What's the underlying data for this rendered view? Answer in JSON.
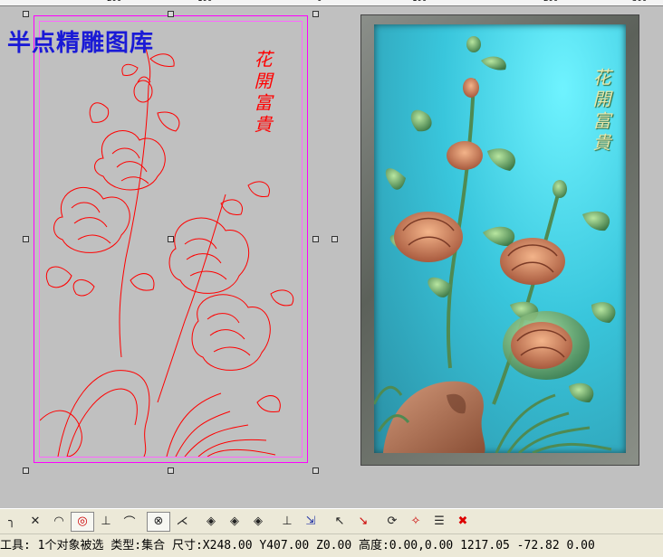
{
  "ruler": {
    "labels": [
      "200",
      "100",
      "0",
      "100",
      "200",
      "300"
    ]
  },
  "watermark": "半点精雕图库",
  "drawing": {
    "caption": "花開富貴",
    "line_color": "#ff0000"
  },
  "relief": {
    "caption": "花開富貴"
  },
  "toolbar": {
    "buttons": [
      {
        "name": "arc-tool-icon",
        "glyph": "╮"
      },
      {
        "name": "trim-tool-icon",
        "glyph": "✕"
      },
      {
        "name": "fillet-tool-icon",
        "glyph": "◠"
      },
      {
        "name": "circle-point-tool-icon",
        "glyph": "◎"
      },
      {
        "name": "perpendicular-tool-icon",
        "glyph": "⊥"
      },
      {
        "name": "tangent-tool-icon",
        "glyph": "⌒"
      },
      {
        "name": "node-tool-icon",
        "glyph": "⊗"
      },
      {
        "name": "angle-tool-icon",
        "glyph": "⋌"
      },
      {
        "name": "diamond-tool-icon",
        "glyph": "◈"
      },
      {
        "name": "diamond-tool-2-icon",
        "glyph": "◈"
      },
      {
        "name": "diamond-tool-3-icon",
        "glyph": "◈"
      },
      {
        "name": "align-bottom-icon",
        "glyph": "⊥"
      },
      {
        "name": "align-arrow-icon",
        "glyph": "⇲"
      },
      {
        "name": "select-node-icon",
        "glyph": "↖"
      },
      {
        "name": "delete-node-icon",
        "glyph": "↘"
      },
      {
        "name": "transform-icon",
        "glyph": "⟳"
      },
      {
        "name": "magic-wand-icon",
        "glyph": "✧"
      },
      {
        "name": "edit-list-icon",
        "glyph": "☰"
      },
      {
        "name": "delete-icon",
        "glyph": "✖"
      }
    ]
  },
  "status": {
    "text": "工具: 1个对象被选 类型:集合 尺寸:X248.00 Y407.00 Z0.00 高度:0.00,0.00 1217.05 -72.82 0.00"
  }
}
